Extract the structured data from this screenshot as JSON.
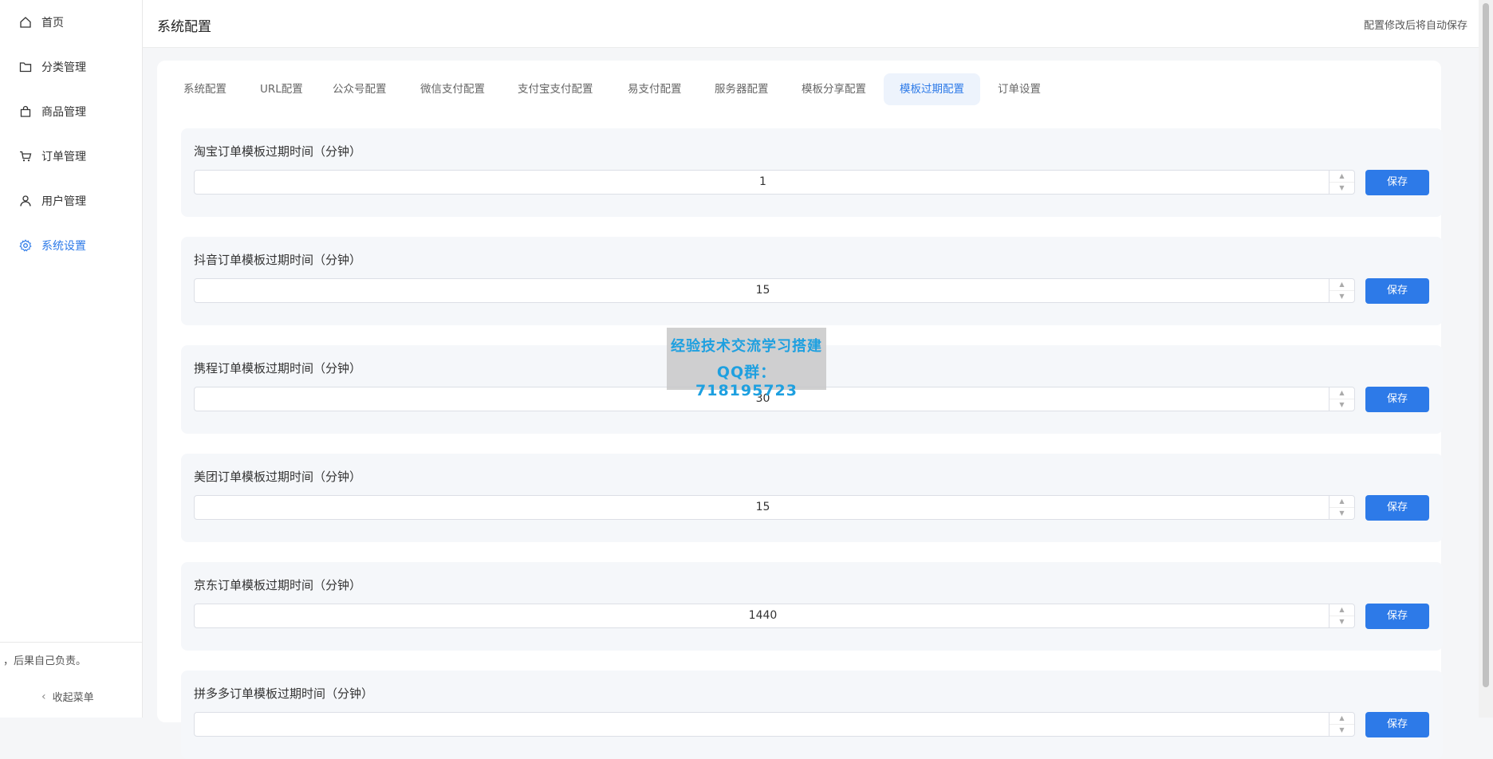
{
  "sidebar": {
    "items": [
      {
        "label": "首页",
        "icon": "home-icon"
      },
      {
        "label": "分类管理",
        "icon": "folder-icon"
      },
      {
        "label": "商品管理",
        "icon": "shopping-bag-icon"
      },
      {
        "label": "订单管理",
        "icon": "cart-icon"
      },
      {
        "label": "用户管理",
        "icon": "user-icon"
      },
      {
        "label": "系统设置",
        "icon": "gear-icon",
        "active": true
      }
    ],
    "notice": "，后果自己负责。",
    "collapse_label": "收起菜单"
  },
  "header": {
    "title": "系统配置",
    "autosave_note": "配置修改后将自动保存"
  },
  "tabs": [
    {
      "label": "系统配置"
    },
    {
      "label": "URL配置"
    },
    {
      "label": "公众号配置"
    },
    {
      "label": "微信支付配置"
    },
    {
      "label": "支付宝支付配置"
    },
    {
      "label": "易支付配置"
    },
    {
      "label": "服务器配置"
    },
    {
      "label": "模板分享配置"
    },
    {
      "label": "模板过期配置",
      "active": true
    },
    {
      "label": "订单设置"
    }
  ],
  "settings": [
    {
      "label": "淘宝订单模板过期时间（分钟）",
      "value": "1",
      "save_label": "保存"
    },
    {
      "label": "抖音订单模板过期时间（分钟）",
      "value": "15",
      "save_label": "保存"
    },
    {
      "label": "携程订单模板过期时间（分钟）",
      "value": "30",
      "save_label": "保存"
    },
    {
      "label": "美团订单模板过期时间（分钟）",
      "value": "15",
      "save_label": "保存"
    },
    {
      "label": "京东订单模板过期时间（分钟）",
      "value": "1440",
      "save_label": "保存"
    },
    {
      "label": "拼多多订单模板过期时间（分钟）",
      "value": "",
      "save_label": "保存"
    }
  ],
  "watermark": {
    "line1": "经验技术交流学习搭建",
    "line2": "QQ群：718195723"
  },
  "colors": {
    "accent": "#2d7ae8",
    "active_tab_bg": "#edf3fc",
    "section_bg": "#f5f7fa",
    "watermark_text": "#1ea0e0"
  }
}
